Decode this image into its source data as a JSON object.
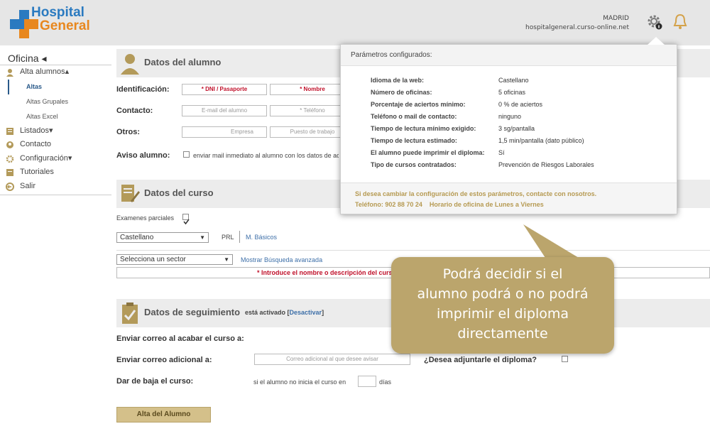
{
  "header": {
    "logo_line1": "Hospital",
    "logo_line2": "General",
    "city": "MADRID",
    "site": "hospitalgeneral.curso-online.net",
    "icons": [
      "gear-icon",
      "bell-icon"
    ]
  },
  "sidebar": {
    "title": "Oficina ◂",
    "items": [
      {
        "label": "Alta alumnos▴",
        "icon": "user-icon"
      },
      {
        "label": "Listados▾",
        "icon": "list-icon"
      },
      {
        "label": "Contacto",
        "icon": "contact-icon"
      },
      {
        "label": "Configuración▾",
        "icon": "gear-icon"
      },
      {
        "label": "Tutoriales",
        "icon": "tutorial-icon"
      },
      {
        "label": "Salir",
        "icon": "exit-icon"
      }
    ],
    "subitems": [
      "Altas",
      "Altas Grupales",
      "Altas Excel"
    ]
  },
  "alumno": {
    "title": "Datos del alumno",
    "identificacion_label": "Identificación:",
    "dni_placeholder": "* DNI / Pasaporte",
    "nombre_placeholder": "* Nombre",
    "contacto_label": "Contacto:",
    "email_placeholder": "E-mail del alumno",
    "telefono_placeholder": "* Teléfono",
    "otros_label": "Otros:",
    "empresa_placeholder": "Empresa",
    "puesto_placeholder": "Puesto de trabajo",
    "aviso_label": "Aviso alumno:",
    "aviso_text": "enviar mail inmediato al alumno con los datos de acceso"
  },
  "curso": {
    "title": "Datos del curso",
    "examenes_label": "Examenes parciales",
    "idioma_value": "Castellano",
    "prl_label": "PRL",
    "basicos_link": "M. Básicos",
    "sector_value": "Selecciona un sector",
    "busqueda_link": "Mostrar Búsqueda avanzada",
    "descripcion_placeholder": "* Introduce el nombre o descripción del curso"
  },
  "seguimiento": {
    "title": "Datos de seguimiento",
    "status_text": "está activado [",
    "deactivate_link": "Desactivar",
    "status_close": "]",
    "acabar_label": "Enviar correo al acabar el curso a:",
    "adicional_label": "Enviar correo adicional a:",
    "adicional_placeholder": "Correo adicional al que desee avisar",
    "adjuntar_label": "¿Desea adjuntarle el diploma?",
    "baja_label": "Dar de baja el curso:",
    "baja_text": "si el alumno no inicia el curso en",
    "dias_label": "días"
  },
  "submit_label": "Alta del Alumno",
  "popup": {
    "title": "Parámetros configurados:",
    "rows": [
      {
        "k": "Idioma de la web:",
        "v": "Castellano"
      },
      {
        "k": "Número de oficinas:",
        "v": "5 oficinas"
      },
      {
        "k": "Porcentaje de aciertos mínimo:",
        "v": "0 % de aciertos"
      },
      {
        "k": "Teléfono o mail de contacto:",
        "v": "ninguno"
      },
      {
        "k": "Tiempo de lectura mínimo exigido:",
        "v": "3 sg/pantalla"
      },
      {
        "k": "Tiempo de lectura estimado:",
        "v": "1,5 min/pantalla (dato público)"
      },
      {
        "k": "El alumno puede imprimir el diploma:",
        "v": "Sí"
      },
      {
        "k": "Tipo de cursos contratados:",
        "v": "Prevención de Riesgos Laborales"
      }
    ],
    "footer_line1": "Si desea cambiar la configuración de estos parámetros, contacte con nosotros.",
    "footer_line2": "Teléfono: 902 88 70 24    Horario de oficina de Lunes a Viernes"
  },
  "callout": {
    "line1": "Podrá decidir si el",
    "line2": "alumno podrá o no podrá",
    "line3": "imprimir el diploma",
    "line4": "directamente"
  },
  "colors": {
    "brand_blue": "#2a7ac0",
    "brand_orange": "#e8871e",
    "accent_gold": "#bba56c",
    "required_red": "#c0102a",
    "link_blue": "#3d6fa8"
  }
}
